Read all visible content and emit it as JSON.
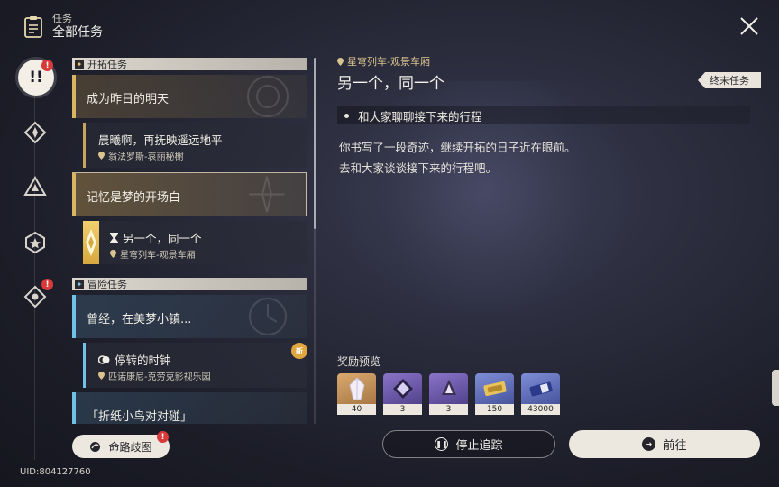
{
  "header": {
    "subtitle": "任务",
    "title": "全部任务"
  },
  "uid": "UID:804127760",
  "categories": {
    "trailblaze": "开拓任务",
    "adventure": "冒险任务"
  },
  "quests": [
    {
      "title": "成为昨日的明天"
    },
    {
      "title": "晨曦啊，再抚映遥远地平",
      "location": "翁法罗斯-哀丽秘榭"
    },
    {
      "title": "记忆是梦的开场白"
    },
    {
      "title": "另一个，同一个",
      "location": "星穹列车-观景车厢"
    },
    {
      "title": "曾经，在美梦小镇..."
    },
    {
      "title": "停转的时钟",
      "location": "匹诺康尼-克劳克影视乐园"
    },
    {
      "title": "「折纸小鸟对对碰」"
    }
  ],
  "new_badge": "新",
  "branch_button": "命路歧图",
  "detail": {
    "location": "星穹列车-观景车厢",
    "title": "另一个，同一个",
    "tag": "终末任务",
    "objective": "和大家聊聊接下来的行程",
    "description_line1": "你书写了一段奇迹，继续开拓的日子近在眼前。",
    "description_line2": "去和大家谈谈接下来的行程吧。"
  },
  "rewards": {
    "label": "奖励预览",
    "items": [
      {
        "icon": "crystal-icon",
        "count": "40"
      },
      {
        "icon": "purple-material-icon",
        "count": "3"
      },
      {
        "icon": "light-cone-material-icon",
        "count": "3"
      },
      {
        "icon": "credit-ticket-icon",
        "count": "150"
      },
      {
        "icon": "pass-ticket-icon",
        "count": "43000"
      }
    ]
  },
  "buttons": {
    "stop": "停止追踪",
    "go": "前往"
  },
  "colors": {
    "gold": "#d9b463",
    "blue": "#6fc2e6",
    "alert": "#d83a3a"
  }
}
